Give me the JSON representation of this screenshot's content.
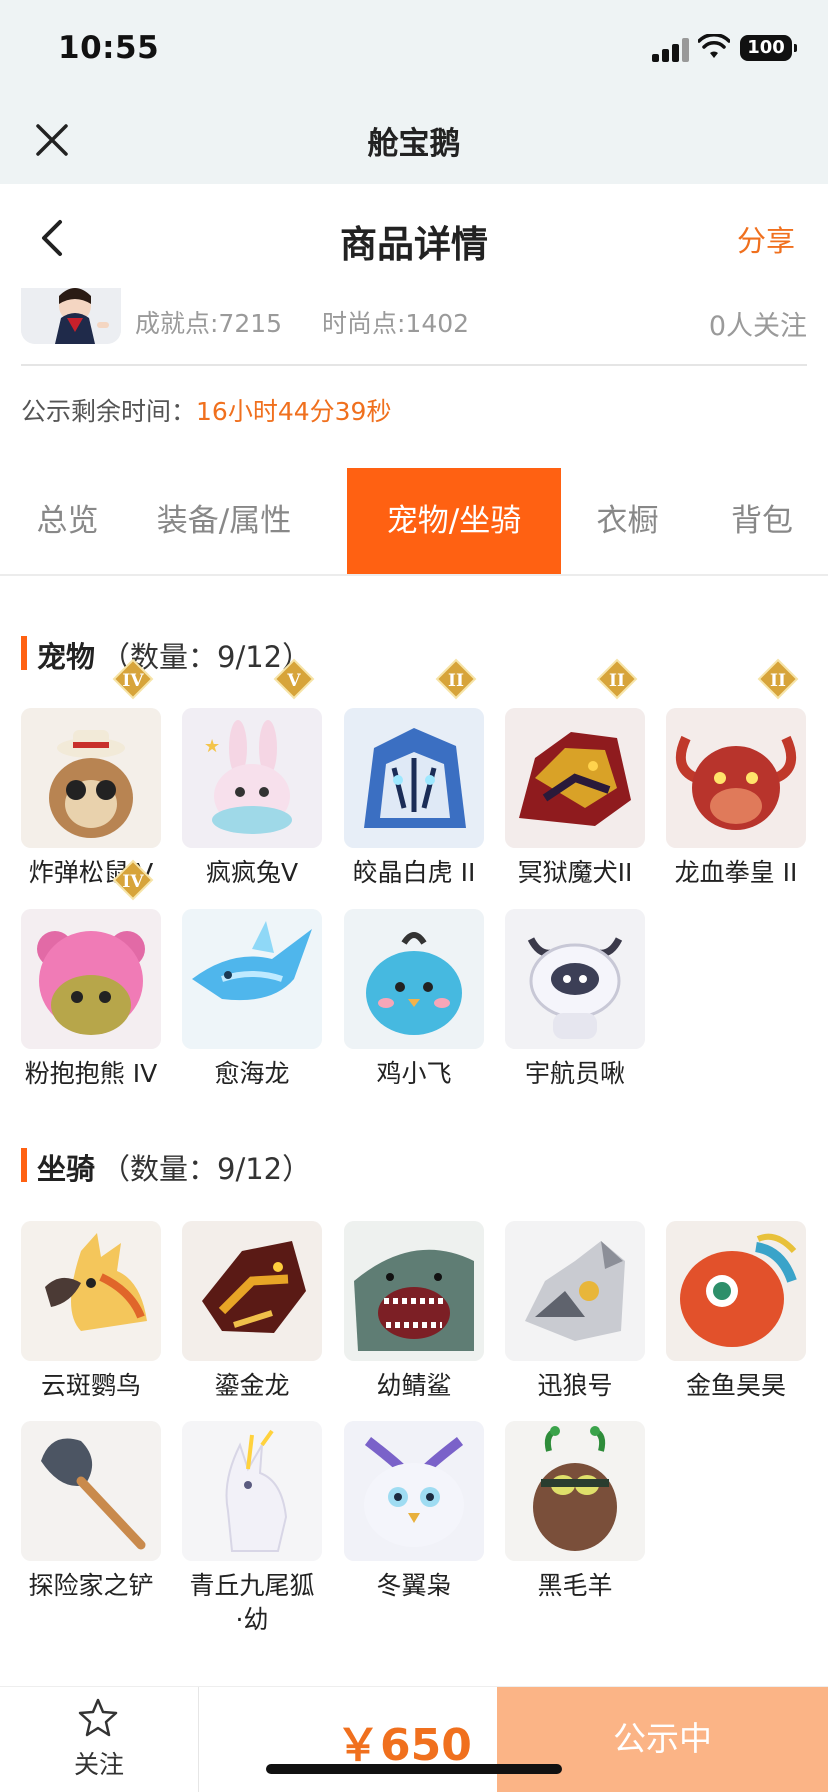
{
  "status_bar": {
    "time": "10:55",
    "battery": "100"
  },
  "app": {
    "title": "舱宝鹅"
  },
  "nav": {
    "title": "商品详情",
    "share": "分享"
  },
  "info": {
    "achievement": "成就点:7215",
    "fashion": "时尚点:1402",
    "followers": "0人关注"
  },
  "countdown": {
    "label": "公示剩余时间：",
    "time": "16小时44分39秒"
  },
  "tabs": [
    {
      "label": "总览",
      "active": false
    },
    {
      "label": "装备/属性",
      "active": false
    },
    {
      "label": "宠物/坐骑",
      "active": true
    },
    {
      "label": "衣橱",
      "active": false
    },
    {
      "label": "背包",
      "active": false
    }
  ],
  "pets": {
    "title": "宠物",
    "count": "（数量：9/12）",
    "items": [
      {
        "name": "炸弹松鼠IV",
        "badge": "IV"
      },
      {
        "name": "疯疯兔V",
        "badge": "V"
      },
      {
        "name": "皎晶白虎 II",
        "badge": "II"
      },
      {
        "name": "冥狱魔犬II",
        "badge": "II"
      },
      {
        "name": "龙血拳皇 II",
        "badge": "II"
      },
      {
        "name": "粉抱抱熊 IV",
        "badge": "IV"
      },
      {
        "name": "愈海龙",
        "badge": ""
      },
      {
        "name": "鸡小飞",
        "badge": ""
      },
      {
        "name": "宇航员啾",
        "badge": ""
      }
    ]
  },
  "mounts": {
    "title": "坐骑",
    "count": "（数量：9/12）",
    "items": [
      {
        "name": "云斑鹦鸟"
      },
      {
        "name": "鎏金龙"
      },
      {
        "name": "幼鲭鲨"
      },
      {
        "name": "迅狼号"
      },
      {
        "name": "金鱼昊昊"
      },
      {
        "name": "探险家之铲"
      },
      {
        "name": "青丘九尾狐\n·幼"
      },
      {
        "name": "冬翼枭"
      },
      {
        "name": "黑毛羊"
      }
    ]
  },
  "footer": {
    "follow": "关注",
    "price": "￥650",
    "status": "公示中"
  },
  "colors": {
    "accent": "#ff6112",
    "price": "#f0701e",
    "status_button": "#fbb486"
  }
}
